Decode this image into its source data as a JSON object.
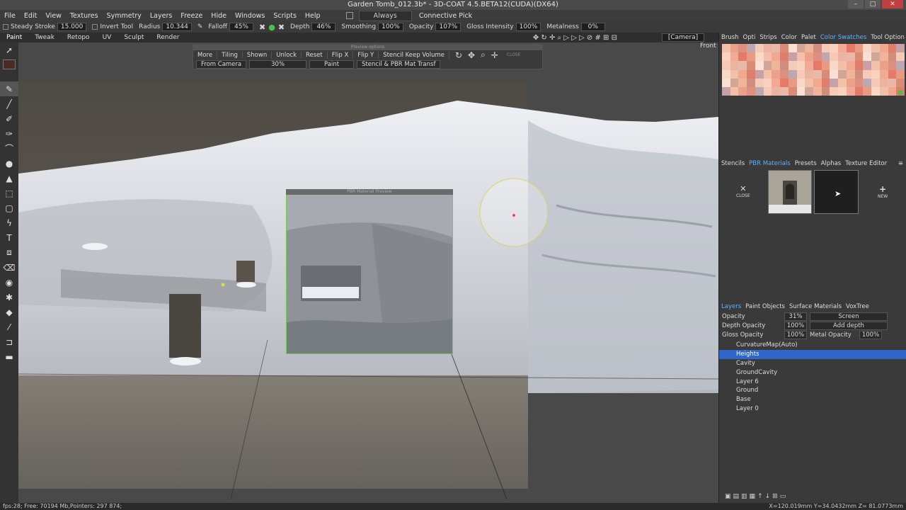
{
  "window": {
    "title": "Garden Tomb_012.3b* - 3D-COAT 4.5.BETA12(CUDA)(DX64)"
  },
  "menu": [
    "File",
    "Edit",
    "View",
    "Textures",
    "Symmetry",
    "Layers",
    "Freeze",
    "Hide",
    "Windows",
    "Scripts",
    "Help"
  ],
  "menubar_extras": {
    "always": "Always",
    "connective": "Connective Pick"
  },
  "toolbar": {
    "steady_stroke_label": "Steady Stroke",
    "steady_stroke_value": "15.000",
    "invert_tool": "Invert Tool",
    "radius_label": "Radius",
    "radius_value": "10.344",
    "falloff_label": "Falloff",
    "falloff_value": "45%",
    "depth_label": "Depth",
    "depth_value": "46%",
    "smoothing_label": "Smoothing",
    "smoothing_value": "100%",
    "opacity_label": "Opacity",
    "opacity_value": "107%",
    "gloss_label": "Gloss Intensity",
    "gloss_value": "100%",
    "metalness_label": "Metalness",
    "metalness_value": "0%",
    "camera": "[Camera]"
  },
  "room_tabs": [
    "Paint",
    "Tweak",
    "Retopo",
    "UV",
    "Sculpt",
    "Render"
  ],
  "viewport": {
    "view_label": "Front"
  },
  "float_panel": {
    "header": "Preview options",
    "row1": [
      "More",
      "Tiling",
      "Shown",
      "Unlock",
      "Reset",
      "Flip X",
      "Flip Y",
      "Stencil Keep Volume"
    ],
    "row2_from": "From Camera",
    "row2_pct": "30%",
    "row2_paint": "Paint",
    "row2_stencil": "Stencil & PBR Mat Transf",
    "close": "CLOSE"
  },
  "preview_header": "PBR Material Preview",
  "right_tabs_top": [
    "Brush",
    "Opti",
    "Strips",
    "Color",
    "Palet",
    "Color Swatches",
    "Tool Option"
  ],
  "right_tabs_top_active": "Color Swatches",
  "right_tabs_mid": [
    "Stencils",
    "PBR Materials",
    "Presets",
    "Alphas",
    "Texture Editor"
  ],
  "right_tabs_mid_active": "PBR Materials",
  "materials": {
    "close": "CLOSE",
    "new": "NEW"
  },
  "layer_tabs": [
    "Layers",
    "Paint Objects",
    "Surface Materials",
    "VoxTree"
  ],
  "layer_tabs_active": "Layers",
  "layer_props": {
    "opacity_label": "Opacity",
    "opacity_value": "31%",
    "blend": "Screen",
    "depth_opacity_label": "Depth Opacity",
    "depth_opacity_value": "100%",
    "depth_mode": "Add depth",
    "gloss_opacity_label": "Gloss Opacity",
    "gloss_opacity_value": "100%",
    "metal_opacity_label": "Metal Opacity",
    "metal_opacity_value": "100%"
  },
  "layers": [
    "CurvatureMap(Auto)",
    "Heights",
    "Cavity",
    "GroundCavity",
    "Layer 6",
    "Ground",
    "Base",
    "Layer 0"
  ],
  "selected_layer": "Heights",
  "status": {
    "left": "fps:28;    Free: 70194 Mb,Pointers: 297 874;",
    "right": "X=120.019mm  Y=34.0432mm  Z= 81.0773mm"
  },
  "colors": {
    "accent": "#5db2ff",
    "selection": "#2f66c8",
    "preview_border": "#77c855"
  }
}
